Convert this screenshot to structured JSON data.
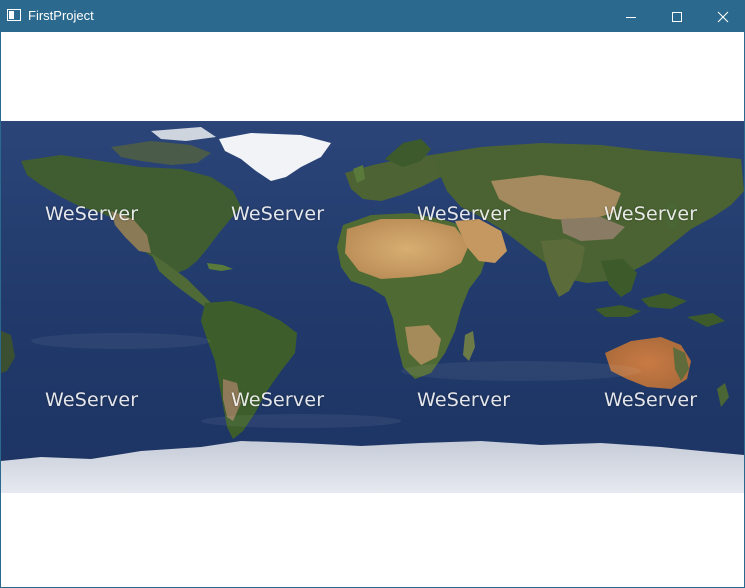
{
  "window": {
    "title": "FirstProject",
    "titlebar_color": "#2b6a8e",
    "controls": [
      "minimize-icon",
      "maximize-icon",
      "close-icon"
    ]
  },
  "map": {
    "type": "world-satellite-imagery",
    "watermark": "WeServer",
    "watermarks": [
      {
        "text": "WeServer"
      },
      {
        "text": "WeServer"
      },
      {
        "text": "WeServer"
      },
      {
        "text": "WeServer"
      },
      {
        "text": "WeServer"
      },
      {
        "text": "WeServer"
      },
      {
        "text": "WeServer"
      },
      {
        "text": "WeServer"
      }
    ],
    "colors": {
      "ocean": "#223c6e",
      "land_forest": "#3d5a2c",
      "land_desert": "#c79a5e",
      "ice": "#e8ecf2"
    }
  }
}
